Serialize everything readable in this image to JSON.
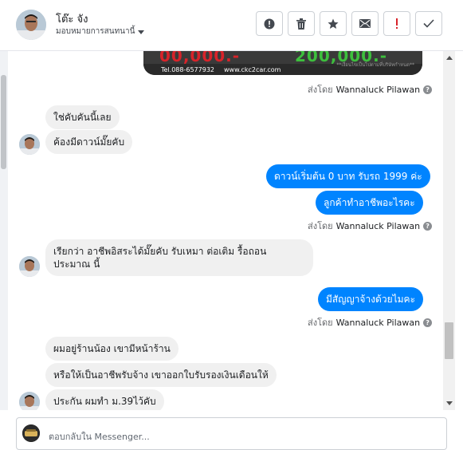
{
  "header": {
    "name": "โต๊ะ จัง",
    "assign_label": "มอบหมายการสนทนานี้",
    "actions": [
      "report-icon",
      "trash-icon",
      "star-icon",
      "mail-icon",
      "exclamation-icon",
      "check-icon"
    ],
    "accent_color": "#d8232a"
  },
  "banner": {
    "price_left": "00,000.-",
    "price_right": "200,000.-",
    "phone": "Tel.088-6577932",
    "site": "www.ckc2car.com",
    "tagline": "**เงื่อนไขเป็นไปตามที่บริษัทกำหนด**"
  },
  "messages": {
    "sent_by_prefix": "ส่งโดย",
    "sent_by_name": "Wannaluck Pilawan",
    "m1": "ใช่คับคันนี้เลย",
    "m2": "ค้องมีดาวน์มั๊ยคับ",
    "m3": "ดาวน์เริ่มต้น 0 บาท รับรถ 1999 ค่ะ",
    "m4": "ลูกค้าทำอาชีพอะไรคะ",
    "m5": "เรียกว่า อาชีพอิสระได้มั๊ยคับ รับเหมา ต่อเติม รื้อถอน ประมาณ นี้",
    "m6": "มีสัญญาจ้างด้วยไมคะ",
    "m7": "ผมอยู่ร้านน้อง เขามีหน้าร้าน",
    "m8": "หรือให้เป็นอาชีพรับจ้าง เขาออกใบรับรองเงินเดือนให้",
    "m9": "ประกัน ผมทำ ม.39ไว้คับ"
  },
  "composer": {
    "placeholder": "ตอบกลับใน Messenger..."
  },
  "colors": {
    "outgoing": "#0084ff",
    "incoming": "#f0f0f0"
  }
}
